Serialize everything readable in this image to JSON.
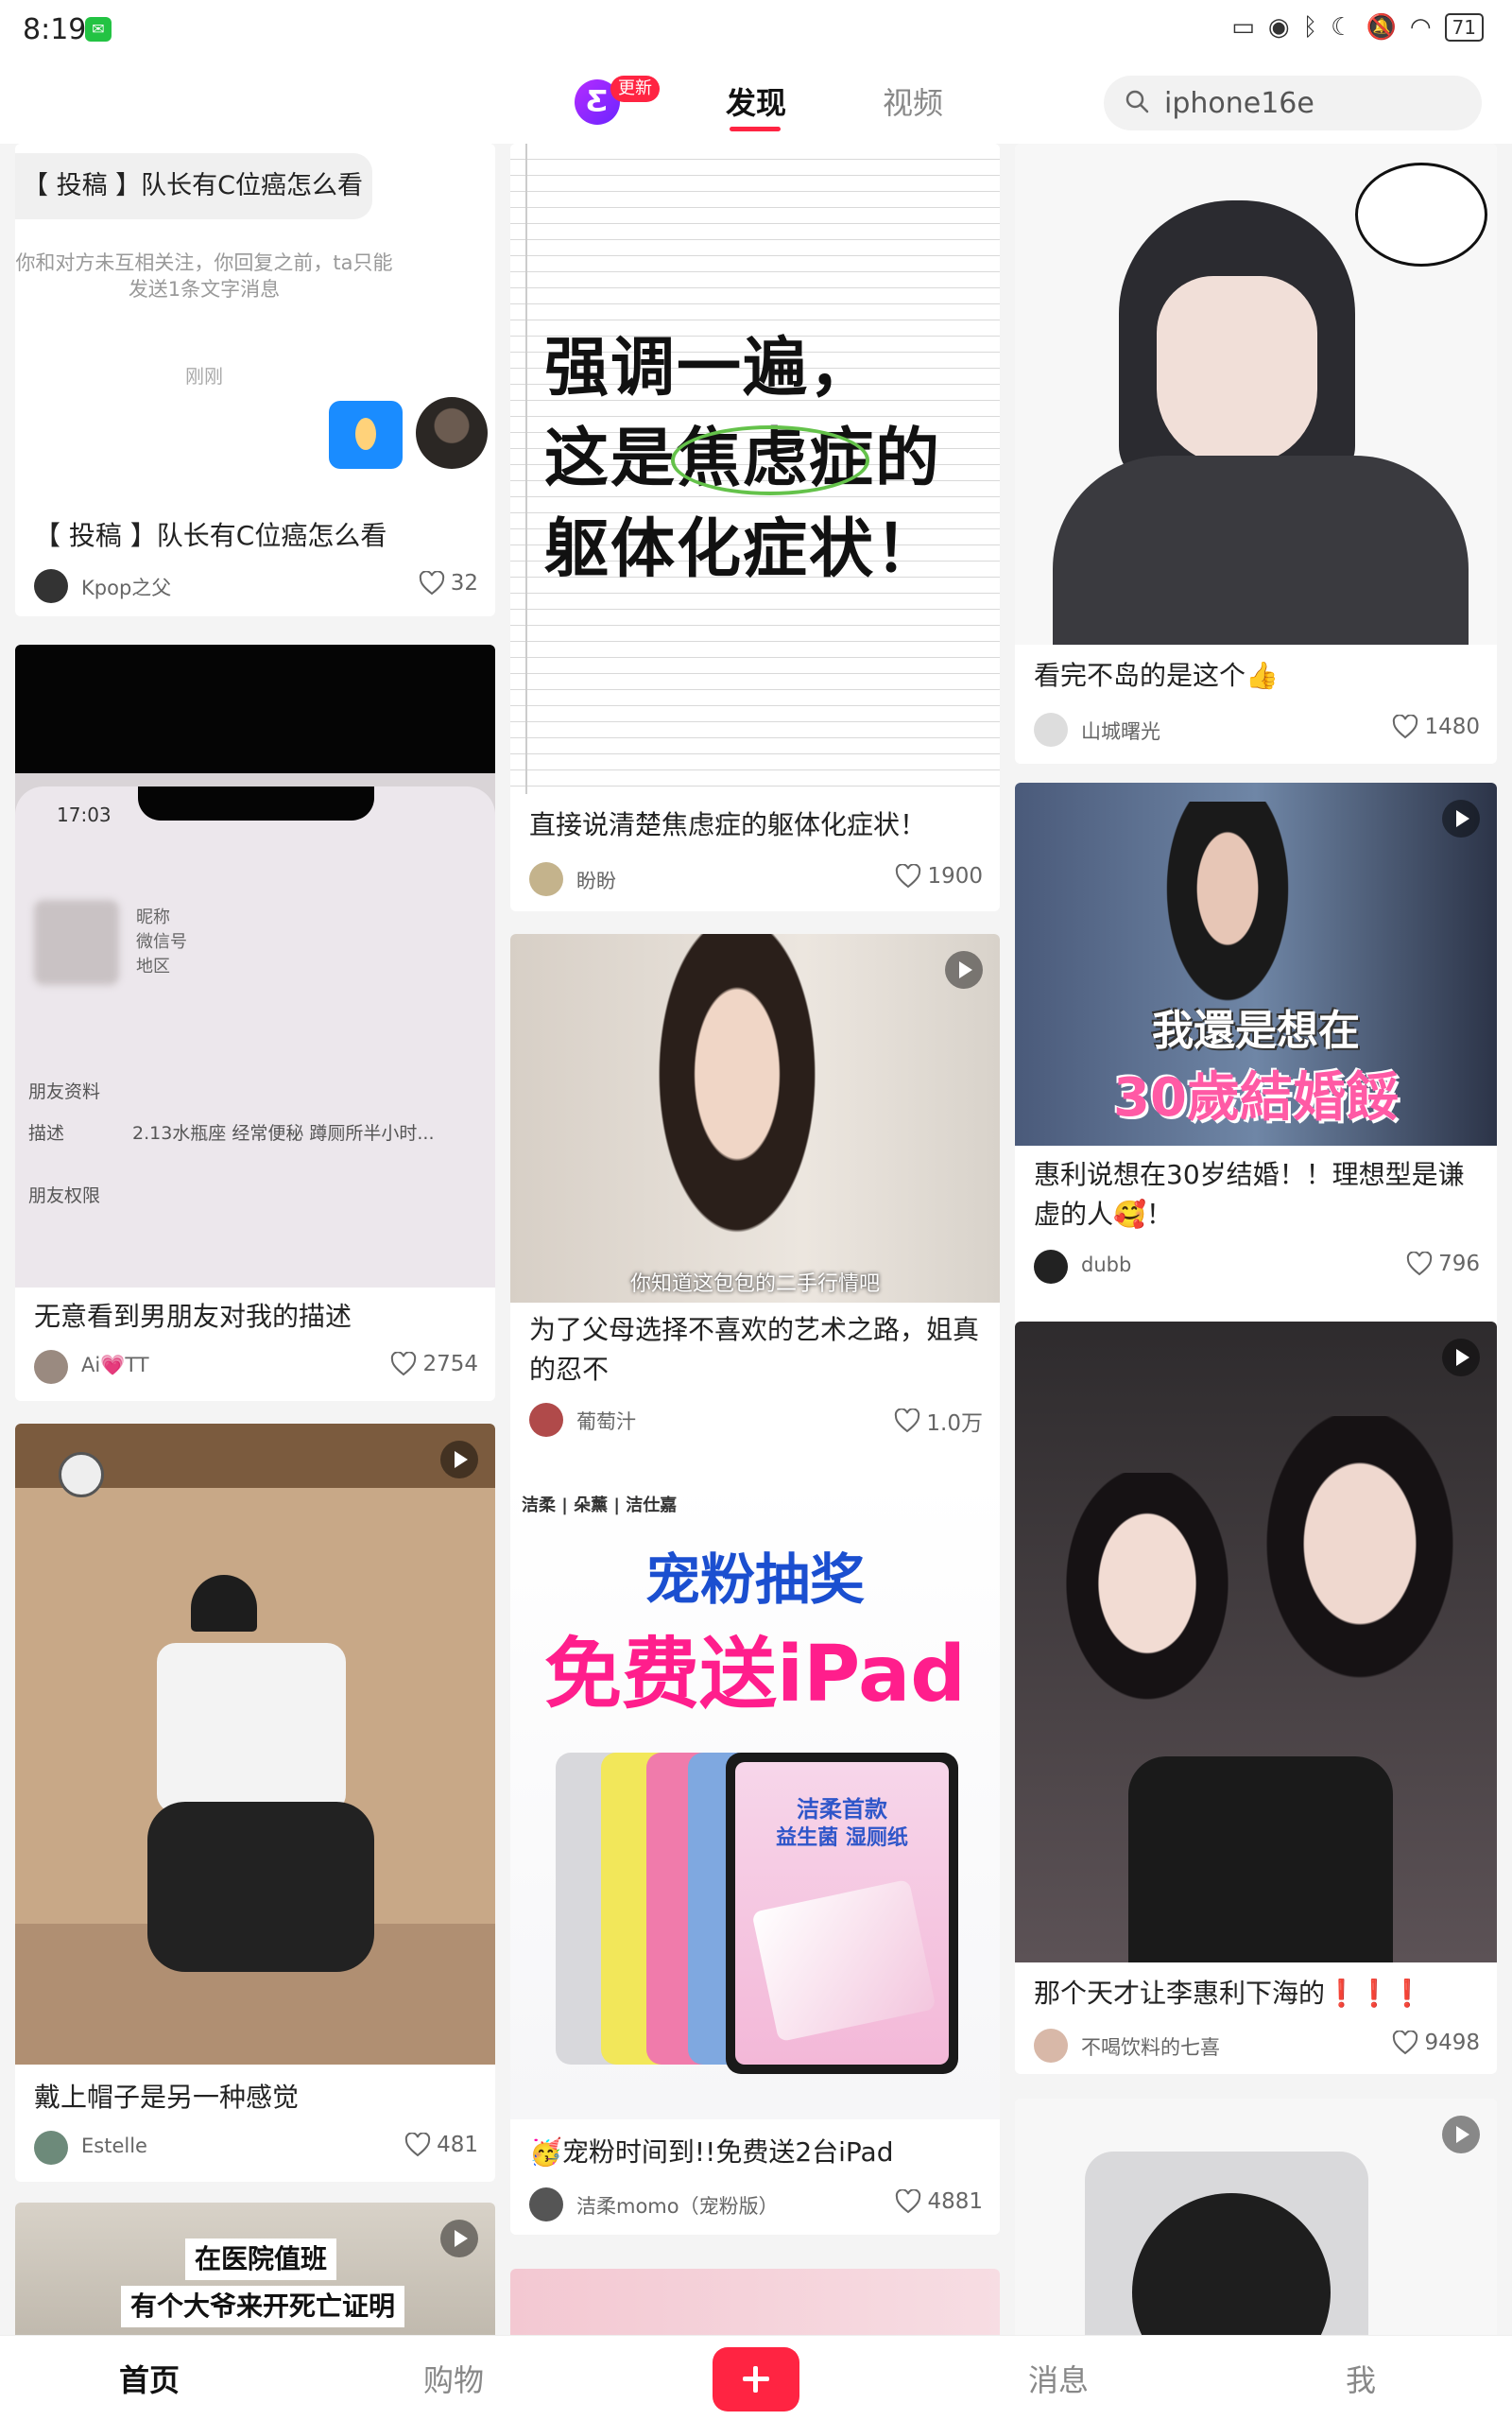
{
  "status_bar": {
    "time": "8:19",
    "battery": "71"
  },
  "header": {
    "logo_badge": "更新",
    "tabs": [
      {
        "label": "发现",
        "active": true
      },
      {
        "label": "视频",
        "active": false
      }
    ],
    "search_value": "iphone16e"
  },
  "accent_color": "#ff2442",
  "cards": [
    {
      "chat_bubble": "【 投稿 】队长有C位癌怎么看",
      "chat_note": "你和对方未互相关注，你回复之前，ta只能发送1条文字消息",
      "chat_time": "刚刚",
      "title": "【 投稿 】队长有C位癌怎么看",
      "author": "Kpop之父",
      "likes": "32"
    },
    {
      "image_text": [
        "强调一遍，",
        "这是焦虑症的",
        "躯体化症状！"
      ],
      "title": "直接说清楚焦虑症的躯体化症状！",
      "author": "盼盼",
      "likes": "1900"
    },
    {
      "title": "看完不岛的是这个👍",
      "author": "山城曙光",
      "likes": "1480"
    },
    {
      "title": "无意看到男朋友对我的描述",
      "author": "Ai💗TT",
      "likes": "2754",
      "phone_screen": {
        "time": "17:03",
        "labels": [
          "昵称",
          "微信号",
          "地区"
        ],
        "row1": "朋友资料",
        "row2_label": "描述",
        "row2_value": "2.13水瓶座 经常便秘 蹲厕所半小时...",
        "row3": "朋友权限"
      }
    },
    {
      "subtitle": "你知道这包包的二手行情吧",
      "title": "为了父母选择不喜欢的艺术之路，姐真的忍不",
      "author": "葡萄汁",
      "likes": "1.0万"
    },
    {
      "caption_line1": "我還是想在",
      "caption_line2": "30歲結婚餒",
      "title": "惠利说想在30岁结婚！！理想型是谦虚的人🥰！",
      "author": "dubb",
      "likes": "796"
    },
    {
      "title": "戴上帽子是另一种感觉",
      "author": "Estelle",
      "likes": "481"
    },
    {
      "ad_brands": "洁柔 | 朵薰 | 洁仕嘉",
      "ad_headline1": "宠粉抽奖",
      "ad_headline2": "免费送iPad",
      "ad_screen1": "洁柔首款",
      "ad_screen2": "益生菌 湿厕纸",
      "title": "🥳宠粉时间到!!免费送2台iPad",
      "author": "洁柔momo（宠粉版）",
      "likes": "4881"
    },
    {
      "title": "那个天才让李惠利下海的❗❗❗",
      "author": "不喝饮料的七喜",
      "likes": "9498"
    },
    {
      "caption_line1": "在医院值班",
      "caption_line2": "有个大爷来开死亡证明"
    }
  ],
  "bottom_nav": {
    "home": "首页",
    "shop": "购物",
    "messages": "消息",
    "me": "我"
  }
}
